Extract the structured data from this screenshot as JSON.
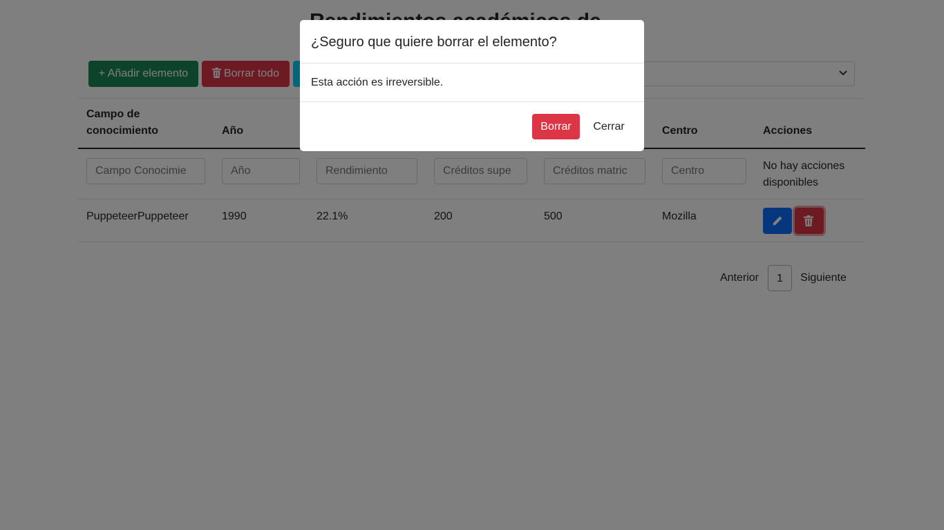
{
  "page": {
    "title": "Rendimientos académicos de",
    "toolbar": {
      "add_label": "+ Añadir elemento",
      "delete_all_label": "Borrar todo",
      "third_label": ""
    }
  },
  "table": {
    "headers": [
      "Campo de conocimiento",
      "Año",
      "",
      "",
      "",
      "Centro",
      "Acciones"
    ],
    "filter_placeholders": [
      "Campo Conocimie",
      "Año",
      "Rendimiento",
      "Créditos supe",
      "Créditos matric",
      "Centro"
    ],
    "no_actions": "No hay acciones disponibles",
    "rows": [
      {
        "campo": "PuppeteerPuppeteer",
        "anio": "1990",
        "rendimiento": "22.1%",
        "creditos_superados": "200",
        "creditos_matriculados": "500",
        "centro": "Mozilla"
      }
    ]
  },
  "pagination": {
    "prev": "Anterior",
    "current": "1",
    "next": "Siguiente"
  },
  "modal": {
    "title": "¿Seguro que quiere borrar el elemento?",
    "body": "Esta acción es irreversible.",
    "delete_label": "Borrar",
    "close_label": "Cerrar"
  },
  "icons": {
    "edit": "pencil-icon",
    "delete": "trash-icon",
    "select": "chevron-down-icon"
  },
  "colors": {
    "success": "#198754",
    "danger": "#dc3545",
    "primary": "#0d6efd",
    "info": "#0dcaf0",
    "backdrop": "rgba(0,0,0,0.5)"
  }
}
